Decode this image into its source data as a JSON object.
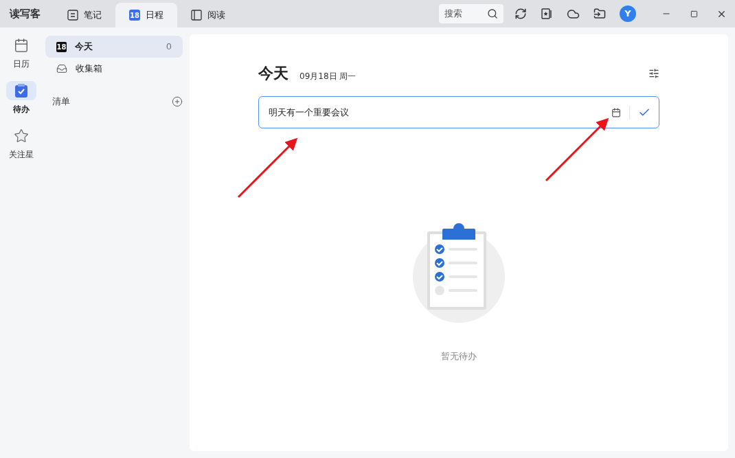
{
  "app_name": "读写客",
  "tabs": [
    {
      "label": "笔记",
      "kind": "note",
      "selected": false
    },
    {
      "label": "日程",
      "kind": "calendar",
      "badge": "18",
      "selected": true
    },
    {
      "label": "阅读",
      "kind": "book",
      "selected": false
    }
  ],
  "search": {
    "placeholder": "搜索"
  },
  "avatar": "Y",
  "rail": [
    {
      "label": "日历",
      "kind": "calendar",
      "selected": false
    },
    {
      "label": "待办",
      "kind": "todo",
      "selected": true
    },
    {
      "label": "关注星",
      "kind": "star",
      "selected": false
    }
  ],
  "lists": [
    {
      "label": "今天",
      "kind": "today",
      "badge": "18",
      "count": "0",
      "selected": true
    },
    {
      "label": "收集箱",
      "kind": "inbox",
      "selected": false
    }
  ],
  "section": {
    "label": "清单"
  },
  "main": {
    "title": "今天",
    "date": "09月18日 周一",
    "input": {
      "value": "明天有一个重要会议"
    },
    "empty_text": "暂无待办"
  },
  "annotations": [
    {
      "kind": "arrow"
    },
    {
      "kind": "arrow"
    }
  ]
}
